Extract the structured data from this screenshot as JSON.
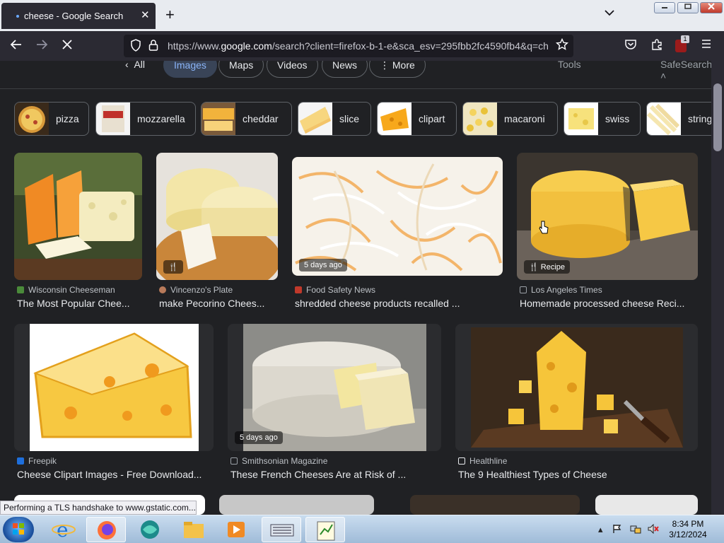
{
  "browser": {
    "tab_title": "cheese - Google Search",
    "tab_close": "✕",
    "new_tab": "+",
    "url_host_prefix": "https://www.",
    "url_host": "google.com",
    "url_rest": "/search?client=firefox-b-1-e&sca_esv=295fbb2fc4590fb4&q=ch",
    "extension_badge": "1",
    "status_text": "Performing a TLS handshake to www.gstatic.com..."
  },
  "search_tabs": {
    "all": "All",
    "images": "Images",
    "maps": "Maps",
    "videos": "Videos",
    "news": "News",
    "more": "More",
    "tools": "Tools",
    "safesearch": "SafeSearch"
  },
  "suggestions": [
    {
      "label": "pizza"
    },
    {
      "label": "mozzarella"
    },
    {
      "label": "cheddar"
    },
    {
      "label": "slice"
    },
    {
      "label": "clipart"
    },
    {
      "label": "macaroni"
    },
    {
      "label": "swiss"
    },
    {
      "label": "string"
    }
  ],
  "results": [
    {
      "source": "Wisconsin Cheeseman",
      "title": "The Most Popular Chee...",
      "badge": ""
    },
    {
      "source": "Vincenzo's Plate",
      "title": "make Pecorino Chees...",
      "badge": ""
    },
    {
      "source": "Food Safety News",
      "title": "shredded cheese products recalled ...",
      "badge": "5 days ago"
    },
    {
      "source": "Los Angeles Times",
      "title": "Homemade processed cheese Reci...",
      "badge": "Recipe"
    },
    {
      "source": "Freepik",
      "title": "Cheese Clipart Images - Free Download...",
      "badge": ""
    },
    {
      "source": "Smithsonian Magazine",
      "title": "These French Cheeses Are at Risk of ...",
      "badge": "5 days ago"
    },
    {
      "source": "Healthline",
      "title": "The 9 Healthiest Types of Cheese",
      "badge": ""
    }
  ],
  "taskbar": {
    "time": "8:34 PM",
    "date": "3/12/2024"
  },
  "colors": {
    "page_bg": "#202124",
    "accent": "#8ab4f8",
    "chrome_dark": "#2b2a33"
  }
}
